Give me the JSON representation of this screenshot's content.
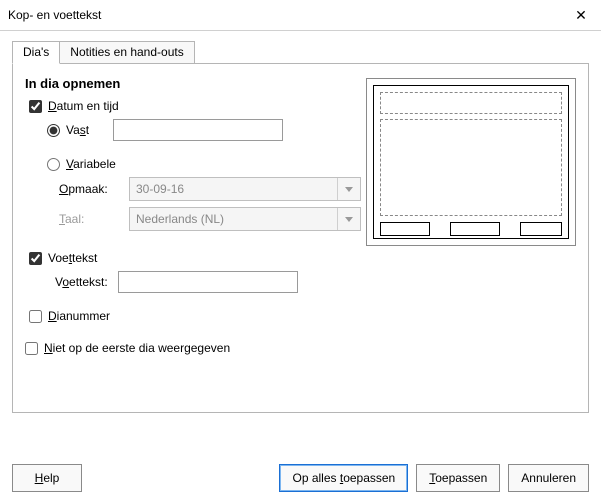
{
  "window": {
    "title": "Kop- en voettekst",
    "close_icon": "close-icon"
  },
  "tabs": {
    "slides": "Dia's",
    "notes": "Notities en hand-outs"
  },
  "section": {
    "title": "In dia opnemen"
  },
  "datetime": {
    "checkbox_pre": "",
    "checkbox_accel": "D",
    "checkbox_post": "atum en tijd",
    "checked": true,
    "fixed": {
      "pre": "Va",
      "accel": "s",
      "post": "t",
      "selected": true,
      "value": ""
    },
    "variable": {
      "pre": "",
      "accel": "V",
      "post": "ariabele",
      "selected": false,
      "format_label_pre": "",
      "format_label_accel": "O",
      "format_label_post": "pmaak:",
      "format_value": "30-09-16",
      "lang_label_pre": "",
      "lang_label_accel": "T",
      "lang_label_post": "aal:",
      "lang_value": "Nederlands (NL)"
    }
  },
  "footer": {
    "chk_pre": "Voe",
    "chk_accel": "t",
    "chk_post": "tekst",
    "checked": true,
    "field_label_pre": "V",
    "field_label_accel": "o",
    "field_label_post": "ettekst:",
    "value": ""
  },
  "slidenr": {
    "pre": "",
    "accel": "D",
    "post": "ianummer",
    "checked": false
  },
  "notfirst": {
    "pre": "",
    "accel": "N",
    "post": "iet op de eerste dia weergegeven",
    "checked": false
  },
  "buttons": {
    "help_pre": "",
    "help_accel": "H",
    "help_post": "elp",
    "apply_all_pre": "Op alles ",
    "apply_all_accel": "t",
    "apply_all_post": "oepassen",
    "apply_pre": "",
    "apply_accel": "T",
    "apply_post": "oepassen",
    "cancel": "Annuleren"
  }
}
